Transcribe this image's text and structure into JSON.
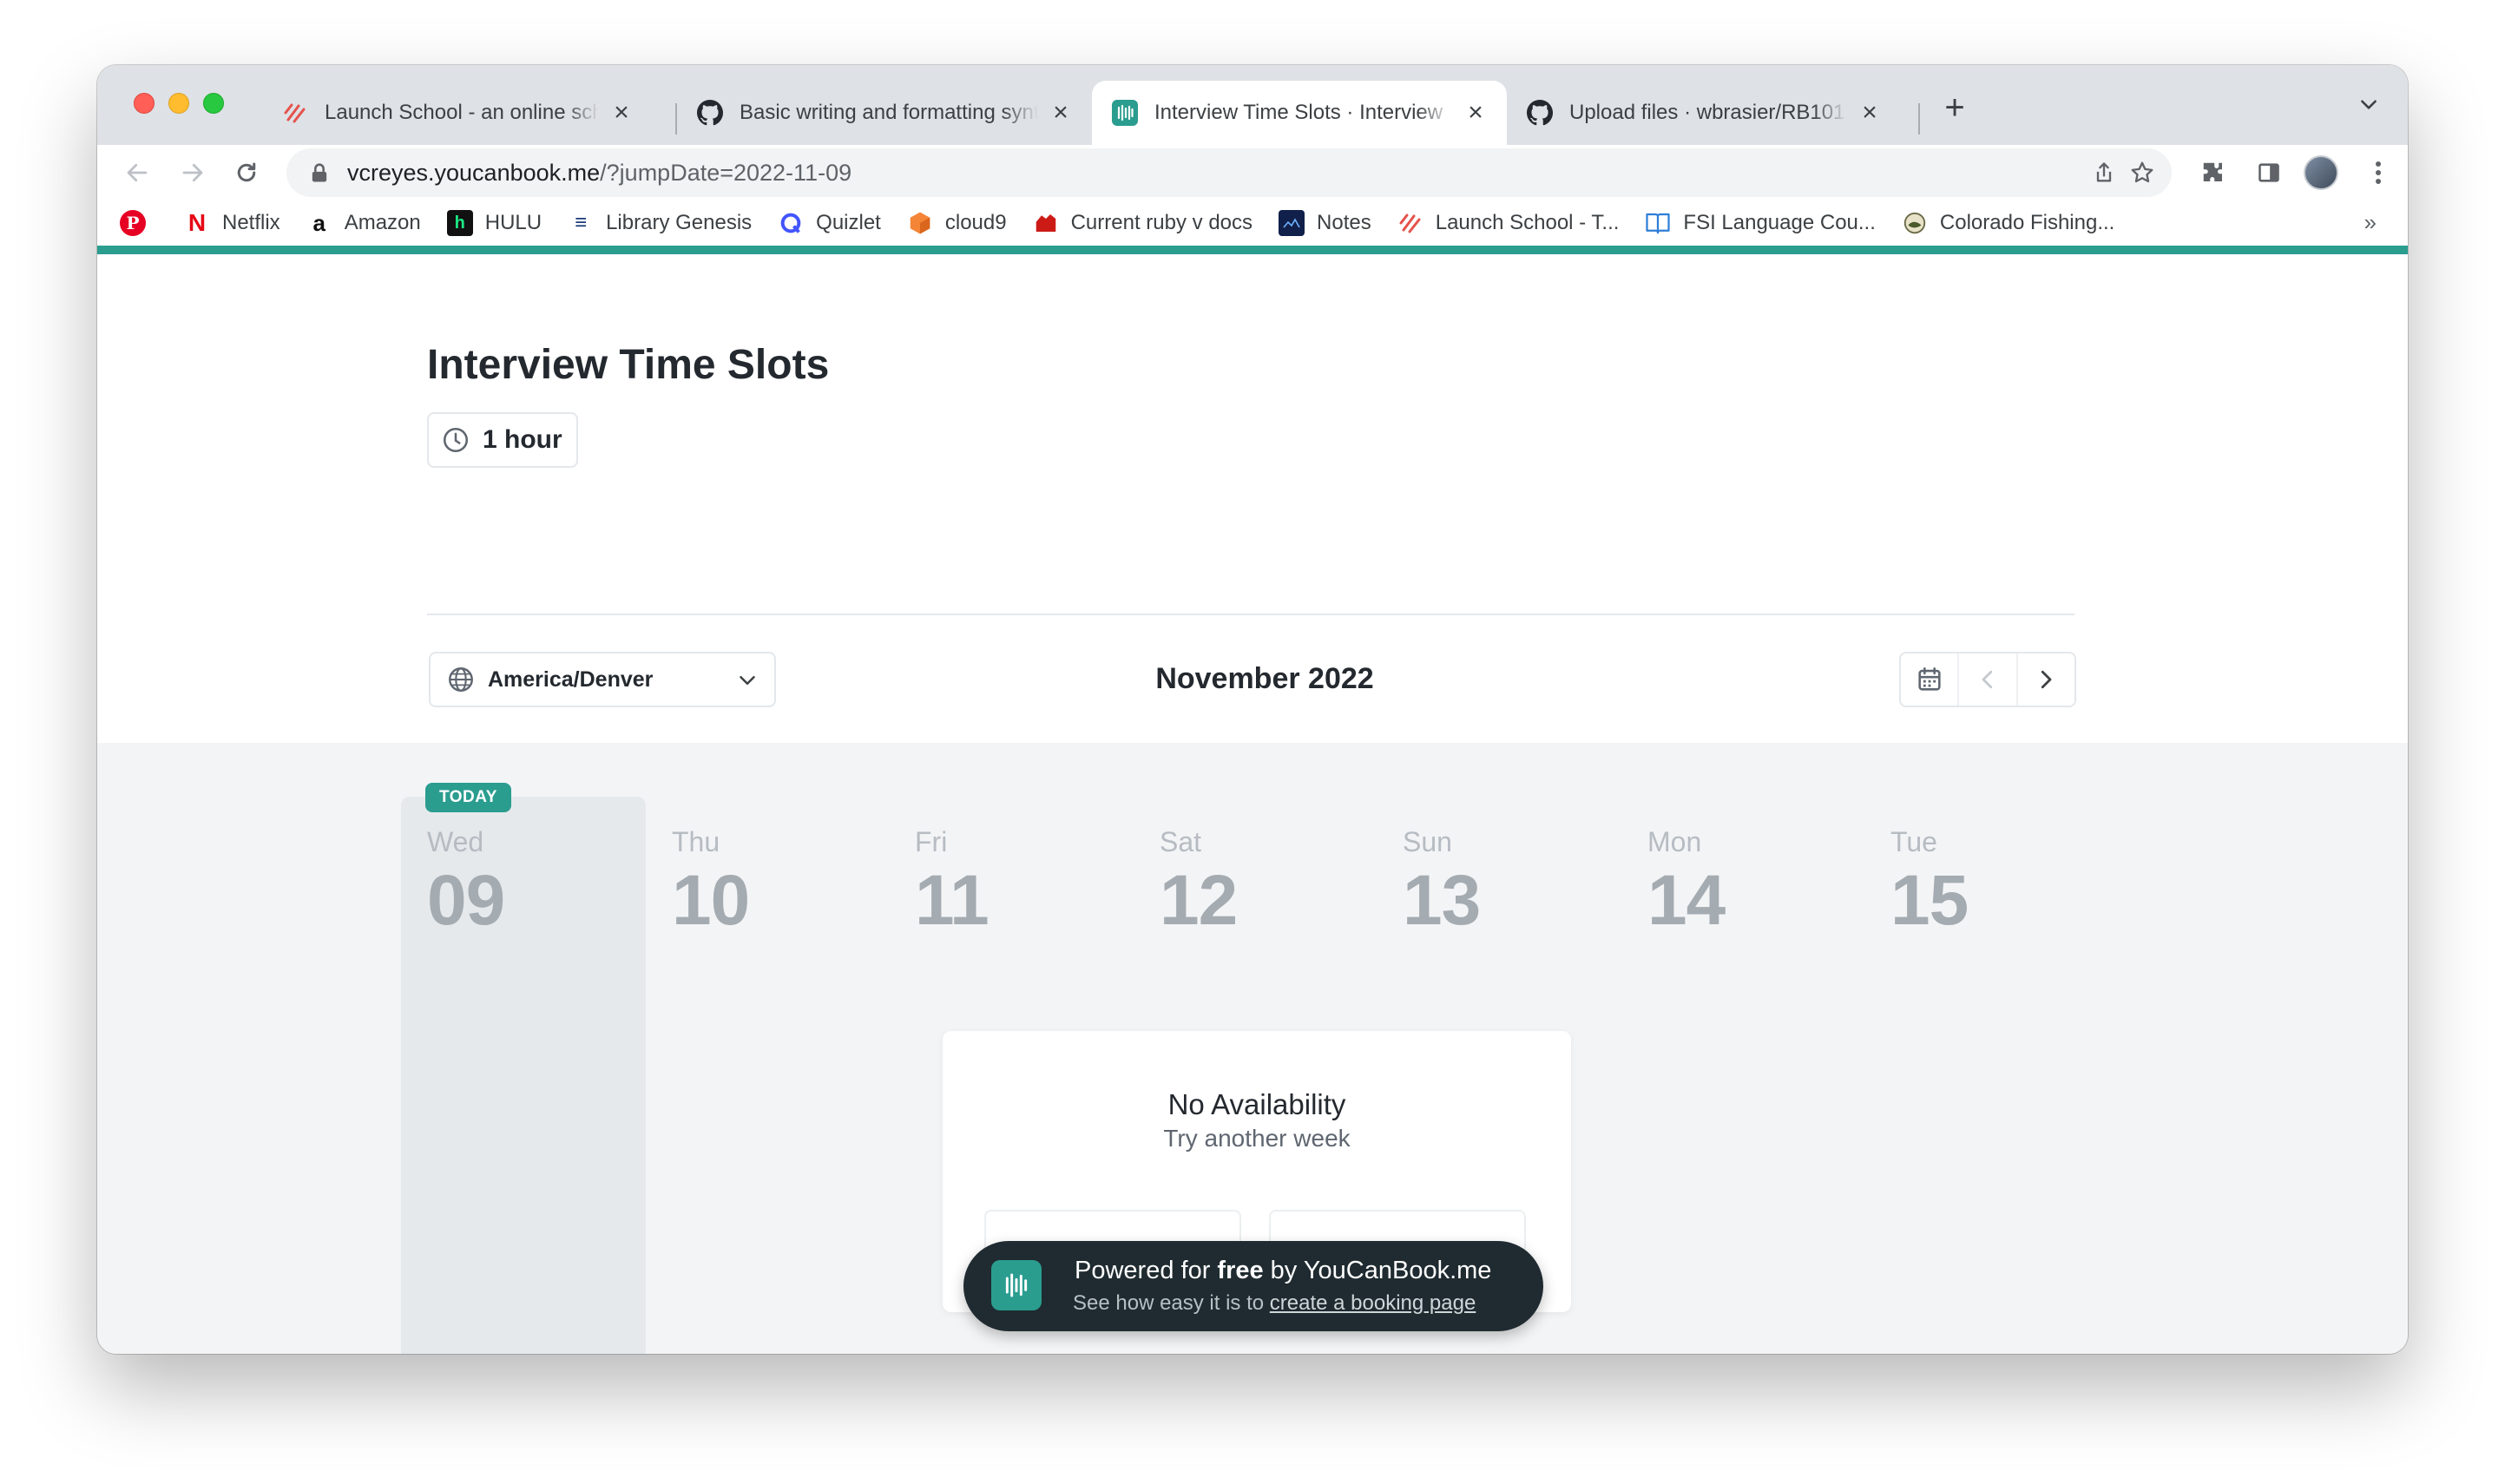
{
  "browser": {
    "tabs": [
      {
        "title": "Launch School - an online school for Software Engineers",
        "icon": "launch-school-icon"
      },
      {
        "title": "Basic writing and formatting syntax - GitHub Docs",
        "icon": "github-icon"
      },
      {
        "title": "Interview Time Slots · Interview",
        "icon": "youcanbookme-icon"
      },
      {
        "title": "Upload files · wbrasier/RB101",
        "icon": "github-icon"
      }
    ],
    "active_tab_index": 2,
    "url_host": "vcreyes.youcanbook.me",
    "url_path": "/?jumpDate=2022-11-09",
    "bookmarks": [
      {
        "label": "",
        "icon": "pinterest-icon"
      },
      {
        "label": "Netflix",
        "icon": "netflix-icon"
      },
      {
        "label": "Amazon",
        "icon": "amazon-icon"
      },
      {
        "label": "HULU",
        "icon": "hulu-icon"
      },
      {
        "label": "Library Genesis",
        "icon": "library-genesis-icon"
      },
      {
        "label": "Quizlet",
        "icon": "quizlet-icon"
      },
      {
        "label": "cloud9",
        "icon": "cloud9-icon"
      },
      {
        "label": "Current ruby v docs",
        "icon": "ruby-icon"
      },
      {
        "label": "Notes",
        "icon": "notes-icon"
      },
      {
        "label": "Launch School - T...",
        "icon": "launch-school-icon"
      },
      {
        "label": "FSI Language Cou...",
        "icon": "book-icon"
      },
      {
        "label": "Colorado Fishing...",
        "icon": "fishing-icon"
      }
    ],
    "bookmarks_overflow": "»"
  },
  "page": {
    "title": "Interview Time Slots",
    "duration": "1 hour",
    "timezone": "America/Denver",
    "month": "November 2022",
    "today_badge": "TODAY",
    "days": [
      {
        "name": "Wed",
        "num": "09"
      },
      {
        "name": "Thu",
        "num": "10"
      },
      {
        "name": "Fri",
        "num": "11"
      },
      {
        "name": "Sat",
        "num": "12"
      },
      {
        "name": "Sun",
        "num": "13"
      },
      {
        "name": "Mon",
        "num": "14"
      },
      {
        "name": "Tue",
        "num": "15"
      }
    ],
    "no_availability": {
      "title": "No Availability",
      "subtitle": "Try another week"
    },
    "powered": {
      "prefix": "Powered for ",
      "bold": "free",
      "suffix": " by YouCanBook.me",
      "line2_prefix": "See how easy it is to ",
      "line2_link": "create a booking page"
    }
  },
  "colors": {
    "accent": "#2a9d8f",
    "today_column": "#e5e9ec",
    "powered_bg": "#1f2b30"
  }
}
